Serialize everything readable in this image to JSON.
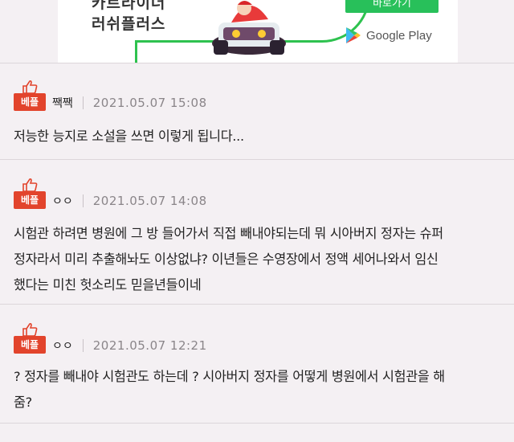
{
  "ad": {
    "title_line1": "카트라이더",
    "title_line2": "러쉬플러스",
    "button_label": "바로가기",
    "store_label": "Google Play",
    "accent": "#28c05a"
  },
  "comments": [
    {
      "badge": "베플",
      "nickname": "짹짹",
      "date": "2021.05.07 15:08",
      "text": "저능한 능지로 소설을 쓰면 이렇게 됩니다..."
    },
    {
      "badge": "베플",
      "nickname": "ㅇㅇ",
      "date": "2021.05.07 14:08",
      "text": "시험관 하려면 병원에 그 방 들어가서 직접 빼내야되는데 뭐 시아버지 정자는 슈퍼\n정자라서 미리 추출해놔도 이상없냐? 이년들은 수영장에서 정액 세어나와서 임신\n했다는 미친 헛소리도 믿을년들이네"
    },
    {
      "badge": "베플",
      "nickname": "ㅇㅇ",
      "date": "2021.05.07 12:21",
      "text": "? 정자를 빼내야 시험관도 하는데 ? 시아버지 정자를 어떻게 병원에서 시험관을 해\n줌?"
    }
  ],
  "colors": {
    "badge": "#e2442c",
    "page_background": "#f4f0f3"
  }
}
